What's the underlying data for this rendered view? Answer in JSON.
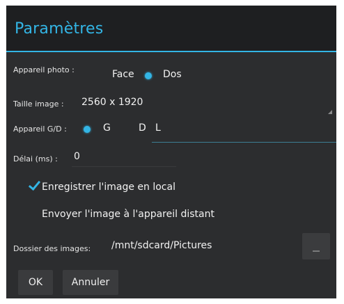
{
  "title": "Paramètres",
  "camera": {
    "label": "Appareil photo :",
    "options": [
      "Face",
      "Dos"
    ],
    "selected": "Face"
  },
  "image_size": {
    "label": "Taille image :",
    "value": "2560 x 1920"
  },
  "lr_camera": {
    "label": "Appareil G/D :",
    "options": [
      "G",
      "D"
    ],
    "selected": "G",
    "field_value": "L"
  },
  "delay": {
    "label": "Délai (ms) :",
    "value": "0"
  },
  "save_local": {
    "label": "Enregistrer l'image en local",
    "checked": true
  },
  "send_remote": {
    "label": "Envoyer l'image à l'appareil distant",
    "checked": false
  },
  "folder": {
    "label": "Dossier des images:",
    "value": "/mnt/sdcard/Pictures"
  },
  "buttons": {
    "ok": "OK",
    "cancel": "Annuler"
  },
  "colors": {
    "accent": "#33b5e5",
    "background": "#2c2d2f",
    "title_bar": "#1e1f21"
  },
  "icons": {
    "radio_selected": "radio-on-icon",
    "checkbox_checked": "check-icon",
    "spinner": "spinner-arrow-icon",
    "browse": "folder-browse-icon"
  }
}
